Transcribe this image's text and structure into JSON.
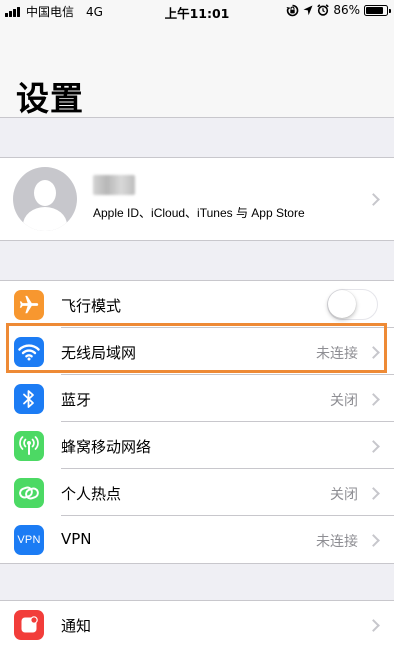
{
  "status_bar": {
    "carrier": "中国电信",
    "network": "4G",
    "time": "上午11:01",
    "battery_percent": "86%",
    "battery_level": 0.86
  },
  "header": {
    "title": "设置"
  },
  "profile": {
    "subtitle": "Apple ID、iCloud、iTunes 与 App Store"
  },
  "settings": {
    "items": [
      {
        "label": "飞行模式",
        "value": "",
        "icon": "airplane-icon",
        "color": "#f7972f",
        "toggle": false
      },
      {
        "label": "无线局域网",
        "value": "未连接",
        "icon": "wifi-icon",
        "color": "#1c7cf4"
      },
      {
        "label": "蓝牙",
        "value": "关闭",
        "icon": "bluetooth-icon",
        "color": "#1c7cf4"
      },
      {
        "label": "蜂窝移动网络",
        "value": "",
        "icon": "cellular-icon",
        "color": "#4cd964"
      },
      {
        "label": "个人热点",
        "value": "关闭",
        "icon": "hotspot-icon",
        "color": "#4cd964"
      },
      {
        "label": "VPN",
        "value": "未连接",
        "icon": "vpn-icon",
        "color": "#1c7cf4",
        "icon_text": "VPN"
      }
    ]
  },
  "notifications": {
    "label": "通知",
    "icon": "notification-icon",
    "color": "#f23d3a"
  },
  "highlight_color": "#ee8a35"
}
